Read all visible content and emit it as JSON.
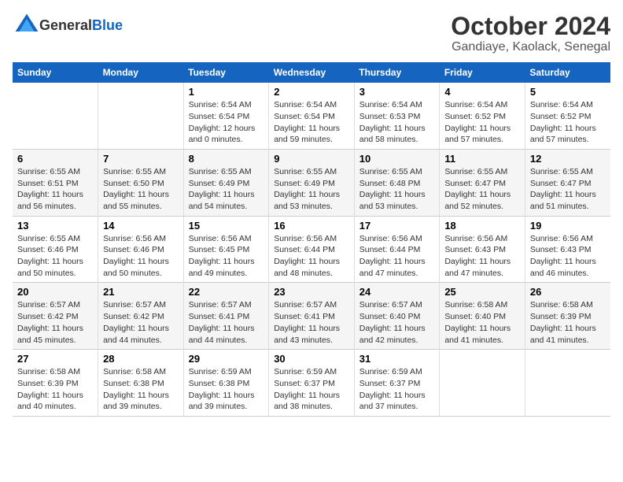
{
  "logo": {
    "text_general": "General",
    "text_blue": "Blue"
  },
  "title": "October 2024",
  "subtitle": "Gandiaye, Kaolack, Senegal",
  "weekdays": [
    "Sunday",
    "Monday",
    "Tuesday",
    "Wednesday",
    "Thursday",
    "Friday",
    "Saturday"
  ],
  "weeks": [
    [
      {
        "day": "",
        "info": ""
      },
      {
        "day": "",
        "info": ""
      },
      {
        "day": "1",
        "info": "Sunrise: 6:54 AM\nSunset: 6:54 PM\nDaylight: 12 hours\nand 0 minutes."
      },
      {
        "day": "2",
        "info": "Sunrise: 6:54 AM\nSunset: 6:54 PM\nDaylight: 11 hours\nand 59 minutes."
      },
      {
        "day": "3",
        "info": "Sunrise: 6:54 AM\nSunset: 6:53 PM\nDaylight: 11 hours\nand 58 minutes."
      },
      {
        "day": "4",
        "info": "Sunrise: 6:54 AM\nSunset: 6:52 PM\nDaylight: 11 hours\nand 57 minutes."
      },
      {
        "day": "5",
        "info": "Sunrise: 6:54 AM\nSunset: 6:52 PM\nDaylight: 11 hours\nand 57 minutes."
      }
    ],
    [
      {
        "day": "6",
        "info": "Sunrise: 6:55 AM\nSunset: 6:51 PM\nDaylight: 11 hours\nand 56 minutes."
      },
      {
        "day": "7",
        "info": "Sunrise: 6:55 AM\nSunset: 6:50 PM\nDaylight: 11 hours\nand 55 minutes."
      },
      {
        "day": "8",
        "info": "Sunrise: 6:55 AM\nSunset: 6:49 PM\nDaylight: 11 hours\nand 54 minutes."
      },
      {
        "day": "9",
        "info": "Sunrise: 6:55 AM\nSunset: 6:49 PM\nDaylight: 11 hours\nand 53 minutes."
      },
      {
        "day": "10",
        "info": "Sunrise: 6:55 AM\nSunset: 6:48 PM\nDaylight: 11 hours\nand 53 minutes."
      },
      {
        "day": "11",
        "info": "Sunrise: 6:55 AM\nSunset: 6:47 PM\nDaylight: 11 hours\nand 52 minutes."
      },
      {
        "day": "12",
        "info": "Sunrise: 6:55 AM\nSunset: 6:47 PM\nDaylight: 11 hours\nand 51 minutes."
      }
    ],
    [
      {
        "day": "13",
        "info": "Sunrise: 6:55 AM\nSunset: 6:46 PM\nDaylight: 11 hours\nand 50 minutes."
      },
      {
        "day": "14",
        "info": "Sunrise: 6:56 AM\nSunset: 6:46 PM\nDaylight: 11 hours\nand 50 minutes."
      },
      {
        "day": "15",
        "info": "Sunrise: 6:56 AM\nSunset: 6:45 PM\nDaylight: 11 hours\nand 49 minutes."
      },
      {
        "day": "16",
        "info": "Sunrise: 6:56 AM\nSunset: 6:44 PM\nDaylight: 11 hours\nand 48 minutes."
      },
      {
        "day": "17",
        "info": "Sunrise: 6:56 AM\nSunset: 6:44 PM\nDaylight: 11 hours\nand 47 minutes."
      },
      {
        "day": "18",
        "info": "Sunrise: 6:56 AM\nSunset: 6:43 PM\nDaylight: 11 hours\nand 47 minutes."
      },
      {
        "day": "19",
        "info": "Sunrise: 6:56 AM\nSunset: 6:43 PM\nDaylight: 11 hours\nand 46 minutes."
      }
    ],
    [
      {
        "day": "20",
        "info": "Sunrise: 6:57 AM\nSunset: 6:42 PM\nDaylight: 11 hours\nand 45 minutes."
      },
      {
        "day": "21",
        "info": "Sunrise: 6:57 AM\nSunset: 6:42 PM\nDaylight: 11 hours\nand 44 minutes."
      },
      {
        "day": "22",
        "info": "Sunrise: 6:57 AM\nSunset: 6:41 PM\nDaylight: 11 hours\nand 44 minutes."
      },
      {
        "day": "23",
        "info": "Sunrise: 6:57 AM\nSunset: 6:41 PM\nDaylight: 11 hours\nand 43 minutes."
      },
      {
        "day": "24",
        "info": "Sunrise: 6:57 AM\nSunset: 6:40 PM\nDaylight: 11 hours\nand 42 minutes."
      },
      {
        "day": "25",
        "info": "Sunrise: 6:58 AM\nSunset: 6:40 PM\nDaylight: 11 hours\nand 41 minutes."
      },
      {
        "day": "26",
        "info": "Sunrise: 6:58 AM\nSunset: 6:39 PM\nDaylight: 11 hours\nand 41 minutes."
      }
    ],
    [
      {
        "day": "27",
        "info": "Sunrise: 6:58 AM\nSunset: 6:39 PM\nDaylight: 11 hours\nand 40 minutes."
      },
      {
        "day": "28",
        "info": "Sunrise: 6:58 AM\nSunset: 6:38 PM\nDaylight: 11 hours\nand 39 minutes."
      },
      {
        "day": "29",
        "info": "Sunrise: 6:59 AM\nSunset: 6:38 PM\nDaylight: 11 hours\nand 39 minutes."
      },
      {
        "day": "30",
        "info": "Sunrise: 6:59 AM\nSunset: 6:37 PM\nDaylight: 11 hours\nand 38 minutes."
      },
      {
        "day": "31",
        "info": "Sunrise: 6:59 AM\nSunset: 6:37 PM\nDaylight: 11 hours\nand 37 minutes."
      },
      {
        "day": "",
        "info": ""
      },
      {
        "day": "",
        "info": ""
      }
    ]
  ]
}
